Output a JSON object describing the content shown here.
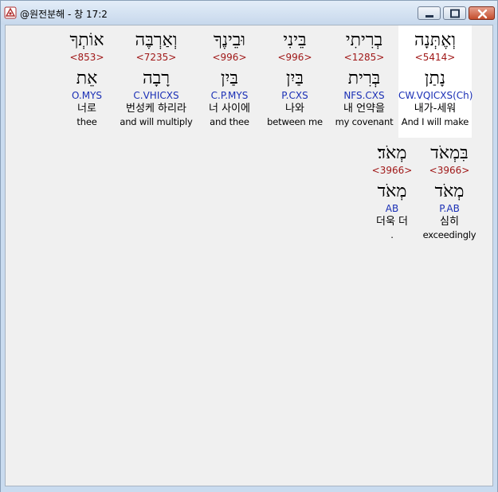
{
  "window": {
    "title": "@원전분해 - 창 17:2"
  },
  "row1": [
    {
      "hebrew": "וְאֶתְּנָה",
      "strong": "<5414>",
      "lemma": "נָתַן",
      "parse": "CW.VQICXS(Ch)",
      "korean": "내가-세워",
      "english": "And I will make",
      "selected": true
    },
    {
      "hebrew": "בְרִיתִי",
      "strong": "<1285>",
      "lemma": "בְּרִית",
      "parse": "NFS.CXS",
      "korean": "내 언약을",
      "english": "my covenant",
      "selected": false
    },
    {
      "hebrew": "בֵּינִי",
      "strong": "<996>",
      "lemma": "בַּיִן",
      "parse": "P.CXS",
      "korean": "나와",
      "english": "between me",
      "selected": false
    },
    {
      "hebrew": "וּבֵינֶךָ",
      "strong": "<996>",
      "lemma": "בַּיִן",
      "parse": "C.P.MYS",
      "korean": "너 사이에",
      "english": "and thee",
      "selected": false
    },
    {
      "hebrew": "וְאַרְבֶּה",
      "strong": "<7235>",
      "lemma": "רָבָה",
      "parse": "C.VHICXS",
      "korean": "번성케 하리라",
      "english": "and will multiply",
      "selected": false
    },
    {
      "hebrew": "אוֹתְךָ",
      "strong": "<853>",
      "lemma": "אֵת",
      "parse": "O.MYS",
      "korean": "너로",
      "english": "thee",
      "selected": false
    }
  ],
  "row2": [
    {
      "hebrew": "בִּמְאֹד",
      "strong": "<3966>",
      "lemma": "מְאֹד",
      "parse": "P.AB",
      "korean": "심히",
      "english": "exceedingly",
      "selected": false
    },
    {
      "hebrew": "מְאֹד׃",
      "strong": "<3966>",
      "lemma": "מְאֹד",
      "parse": "AB",
      "korean": "더욱 더",
      "english": ".",
      "selected": false
    }
  ]
}
